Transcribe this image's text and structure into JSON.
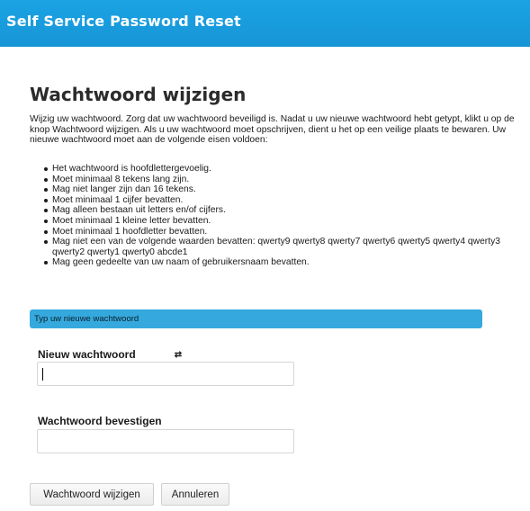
{
  "header": {
    "title": "Self Service Password Reset"
  },
  "main": {
    "title": "Wachtwoord wijzigen",
    "intro": "Wijzig uw wachtwoord. Zorg dat uw wachtwoord beveiligd is. Nadat u uw nieuwe wachtwoord hebt getypt, klikt u op de knop Wachtwoord wijzigen. Als u uw wachtwoord moet opschrijven, dient u het op een veilige plaats te bewaren. Uw nieuwe wachtwoord moet aan de volgende eisen voldoen:",
    "rules": [
      "Het wachtwoord is hoofdlettergevoelig.",
      "Moet minimaal 8 tekens lang zijn.",
      "Mag niet langer zijn dan 16 tekens.",
      "Moet minimaal 1 cijfer bevatten.",
      "Mag alleen bestaan uit letters en/of cijfers.",
      "Moet minimaal 1 kleine letter bevatten.",
      "Moet minimaal 1 hoofdletter bevatten.",
      "Mag niet een van de volgende waarden bevatten: qwerty9 qwerty8 qwerty7 qwerty6 qwerty5 qwerty4 qwerty3 qwerty2 qwerty1 qwerty0 abcde1",
      "Mag geen gedeelte van uw naam of gebruikersnaam bevatten."
    ]
  },
  "form": {
    "section_label": "Typ uw nieuwe wachtwoord",
    "new_password": {
      "label": "Nieuw wachtwoord",
      "value": "",
      "toggle_icon": "refresh-icon"
    },
    "confirm_password": {
      "label": "Wachtwoord bevestigen",
      "value": ""
    }
  },
  "actions": {
    "save_label": "Wachtwoord wijzigen",
    "cancel_label": "Annuleren"
  },
  "colors": {
    "header_bg": "#1ba1e2",
    "section_bar_bg": "#35a9dd"
  }
}
